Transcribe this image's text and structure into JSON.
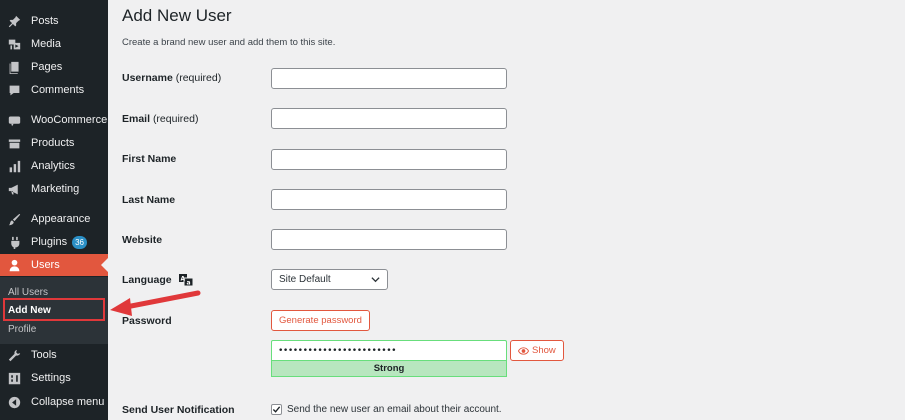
{
  "sidebar": {
    "items": [
      {
        "label": "Posts",
        "icon": "pin-icon"
      },
      {
        "label": "Media",
        "icon": "media-icon"
      },
      {
        "label": "Pages",
        "icon": "pages-icon"
      },
      {
        "label": "Comments",
        "icon": "comment-icon"
      },
      {
        "label": "WooCommerce",
        "icon": "woocommerce-icon"
      },
      {
        "label": "Products",
        "icon": "products-icon"
      },
      {
        "label": "Analytics",
        "icon": "analytics-icon"
      },
      {
        "label": "Marketing",
        "icon": "megaphone-icon"
      },
      {
        "label": "Appearance",
        "icon": "brush-icon"
      },
      {
        "label": "Plugins",
        "icon": "plugin-icon",
        "badge": "36"
      },
      {
        "label": "Users",
        "icon": "user-icon",
        "active": true
      },
      {
        "label": "Tools",
        "icon": "wrench-icon"
      },
      {
        "label": "Settings",
        "icon": "settings-icon"
      },
      {
        "label": "Collapse menu",
        "icon": "collapse-icon"
      }
    ],
    "submenu": {
      "all_users": "All Users",
      "add_new": "Add New",
      "profile": "Profile"
    }
  },
  "page": {
    "title": "Add New User",
    "description": "Create a brand new user and add them to this site."
  },
  "form": {
    "username": {
      "label": "Username",
      "suffix": "(required)",
      "value": ""
    },
    "email": {
      "label": "Email",
      "suffix": "(required)",
      "value": ""
    },
    "first_name": {
      "label": "First Name",
      "value": ""
    },
    "last_name": {
      "label": "Last Name",
      "value": ""
    },
    "website": {
      "label": "Website",
      "value": ""
    },
    "language": {
      "label": "Language",
      "selected": "Site Default"
    },
    "password": {
      "label": "Password",
      "generate_button": "Generate password",
      "value": "••••••••••••••••••••••••",
      "strength": "Strength indicator",
      "strength_text": "Strong",
      "show_button": "Show"
    },
    "notification": {
      "label": "Send User Notification",
      "checkbox_text": "Send the new user an email about their account.",
      "checked": true
    }
  },
  "colors": {
    "sidebar_bg": "#1d2327",
    "accent": "#e2573e",
    "highlight": "#e0383a",
    "strength_bg": "#b8e6bf",
    "badge": "#2a8fc6"
  }
}
